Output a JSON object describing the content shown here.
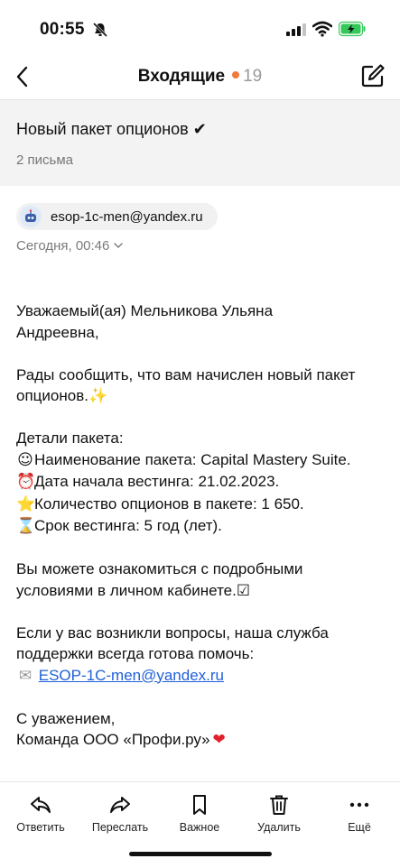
{
  "status_bar": {
    "time": "00:55",
    "icons": [
      "bell-slash-icon",
      "signal-icon",
      "wifi-icon",
      "battery-charging-icon"
    ],
    "battery_color": "#34c759"
  },
  "nav": {
    "title": "Входящие",
    "unread_count": "19",
    "dot_color": "#f07a3a",
    "icons": [
      "chevron-left-icon",
      "compose-icon"
    ]
  },
  "thread": {
    "subject": "Новый пакет опционов ✔",
    "count": "2 письма"
  },
  "message": {
    "sender": "esop-1c-men@yandex.ru",
    "date": "Сегодня, 00:46",
    "body": {
      "greeting_1": "Уважаемый(ая) Мельникова Ульяна",
      "greeting_2": "Андреевна,",
      "intro_1": "Рады сообщить, что вам начислен новый пакет",
      "intro_2": "опционов.✨",
      "details_title": "Детали пакета:",
      "details": [
        {
          "emoji": "☺",
          "text": "Наименование пакета: Capital Mastery Suite."
        },
        {
          "emoji": "⏰",
          "text": "Дата начала вестинга: 21.02.2023."
        },
        {
          "emoji": "⭐",
          "text": "Количество опционов в пакете: 1 650."
        },
        {
          "emoji": "⌛",
          "text": "Срок вестинга: 5 год (лет)."
        }
      ],
      "info_1": "Вы можете ознакомиться с подробными",
      "info_2": "условиями в личном кабинете.☑",
      "support_1": "Если у вас возникли вопросы, наша служба",
      "support_2": "поддержки всегда готова помочь:",
      "support_emoji": "✉",
      "support_email": "ESOP-1C-men@yandex.ru",
      "closing_1": "С уважением,",
      "closing_2": "Команда ООО «Профи.ру»",
      "closing_emoji": "❤"
    }
  },
  "toolbar": {
    "reply": "Ответить",
    "forward": "Переслать",
    "important": "Важное",
    "delete": "Удалить",
    "more": "Ещё"
  }
}
